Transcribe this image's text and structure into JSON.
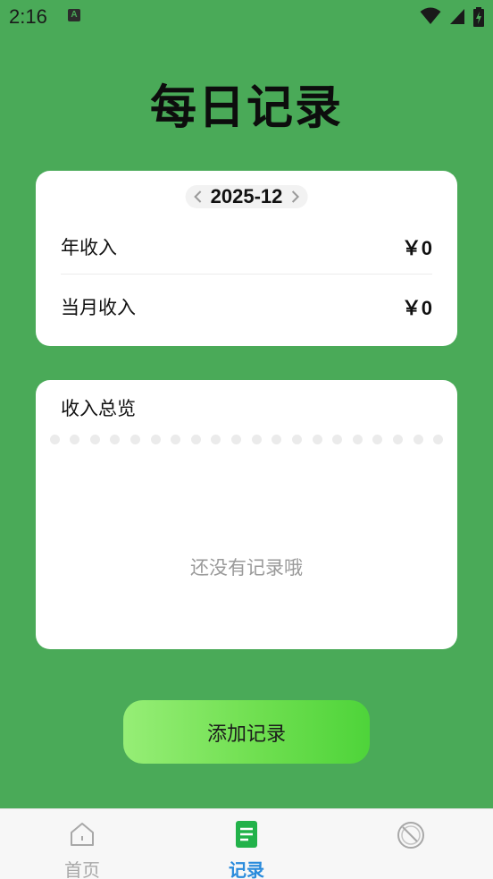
{
  "status_bar": {
    "time": "2:16",
    "notification_glyph": "A",
    "icons": [
      "wifi-icon",
      "signal-icon",
      "battery-icon"
    ]
  },
  "page": {
    "title": "每日记录"
  },
  "summary": {
    "month_picker": {
      "prev_icon": "chevron-left-icon",
      "value": "2025-12",
      "next_icon": "chevron-right-icon"
    },
    "year_income": {
      "label": "年收入",
      "value": "￥0"
    },
    "month_income": {
      "label": "当月收入",
      "value": "￥0"
    }
  },
  "overview": {
    "title": "收入总览",
    "empty_text": "还没有记录哦"
  },
  "actions": {
    "add_label": "添加记录"
  },
  "tab_bar": {
    "active_color": "#2a8bdc",
    "inactive_color": "#a8a8a8",
    "tabs": [
      {
        "label": "首页",
        "icon": "home-icon",
        "active": false
      },
      {
        "label": "记录",
        "icon": "document-icon",
        "active": true
      },
      {
        "label": "",
        "icon": "dial-icon",
        "active": false
      }
    ]
  },
  "colors": {
    "background": "#4aaa58",
    "card": "#ffffff",
    "button_gradient_start": "#96ee76",
    "button_gradient_end": "#4ed43a"
  }
}
